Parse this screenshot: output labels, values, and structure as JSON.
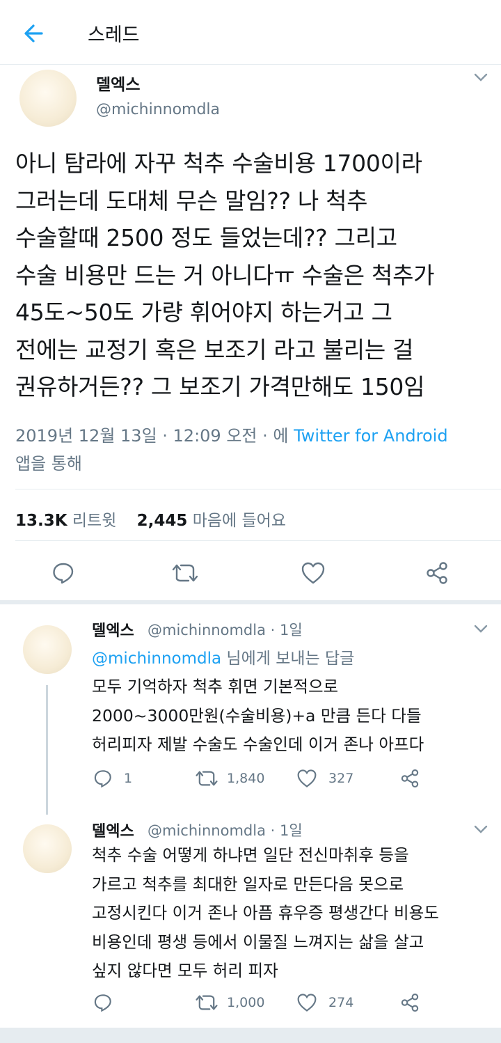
{
  "header": {
    "title": "스레드"
  },
  "main_tweet": {
    "author_name": "델엑스",
    "author_handle": "@michinnomdla",
    "text_lines": [
      "아니 탐라에 자꾸 척추 수술비용 1700이라",
      "그러는데 도대체 무슨 말임?? 나 척추",
      "수술할때 2500 정도 들었는데?? 그리고",
      "수술 비용만 드는 거 아니다ㅠ 수술은 척추가",
      "45도~50도 가량 휘어야지 하는거고 그",
      "전에는 교정기 혹은 보조기 라고 불리는 걸",
      "권유하거든?? 그 보조기 가격만해도 150임"
    ],
    "timestamp": "2019년 12월 13일 · 12:09 오전 · 에 ",
    "source": "Twitter for Android",
    "source_suffix": "앱을 통해",
    "retweet_count": "13.3K",
    "retweet_label": "리트윗",
    "like_count": "2,445",
    "like_label": "마음에 들어요"
  },
  "replies": [
    {
      "author_name": "델엑스",
      "author_handle": "@michinnomdla · 1일",
      "reply_to_handle": "@michinnomdla",
      "reply_to_suffix": " 님에게 보내는 답글",
      "text_lines": [
        "모두 기억하자 척추 휘면 기본적으로",
        "2000~3000만원(수술비용)+a 만큼 든다 다들",
        "허리피자 제발 수술도 수술인데 이거 존나 아프다"
      ],
      "reply_count": "1",
      "retweet_count": "1,840",
      "like_count": "327"
    },
    {
      "author_name": "델엑스",
      "author_handle": "@michinnomdla · 1일",
      "text_lines": [
        "척추 수술 어떻게 하냐면 일단 전신마취후 등을",
        "가르고 척추를 최대한 일자로 만든다음 못으로",
        "고정시킨다 이거 존나 아픔 휴우증 평생간다 비용도",
        "비용인데 평생 등에서 이물질 느껴지는 삶을 살고",
        "싶지 않다면 모두 허리 피자"
      ],
      "reply_count": "",
      "retweet_count": "1,000",
      "like_count": "274"
    }
  ],
  "icons": {
    "back": "arrow-left-icon",
    "chevron": "chevron-down-icon",
    "reply": "comment-icon",
    "retweet": "retweet-icon",
    "like": "heart-icon",
    "share": "share-icon"
  },
  "colors": {
    "accent": "#1da1f2",
    "muted": "#657786",
    "text": "#14171a",
    "border": "#e6ecf0"
  }
}
